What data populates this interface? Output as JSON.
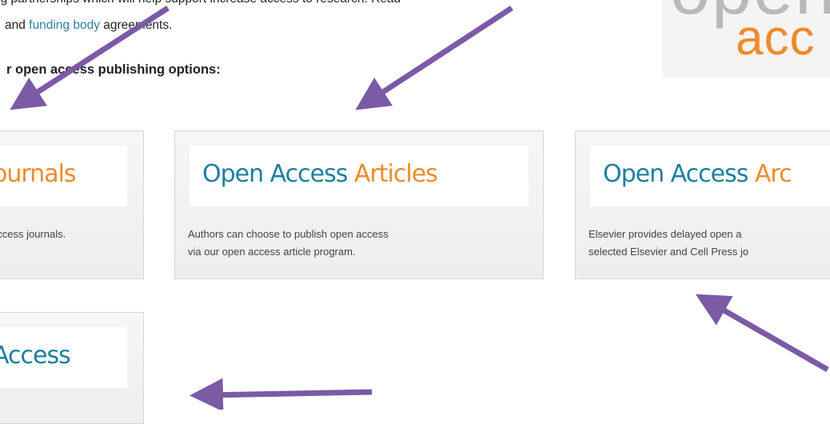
{
  "intro": {
    "line1": "ng partnerships which will help support increase access to research. Read",
    "line2_prefix": "and ",
    "line2_link": "funding body",
    "line2_suffix": " agreements."
  },
  "options_heading": "r open access publishing options:",
  "logo": {
    "top_text": "open",
    "bottom_text": "acc"
  },
  "cards": [
    {
      "title_blue": "",
      "title_orange": "ournals",
      "desc": "access journals."
    },
    {
      "title_blue": "Open Access ",
      "title_orange": "Articles",
      "desc_line1": "Authors can choose to publish open access",
      "desc_line2": "via our open access article program."
    },
    {
      "title_blue": "Open Access ",
      "title_orange": "Arc",
      "desc_line1": "Elsevier provides delayed open a",
      "desc_line2": "selected Elsevier and Cell Press jo"
    },
    {
      "title_blue": "Access",
      "title_orange": ""
    }
  ],
  "colors": {
    "arrow": "#7b5aa6",
    "blue": "#1a7fa0",
    "orange": "#f08a2a"
  }
}
